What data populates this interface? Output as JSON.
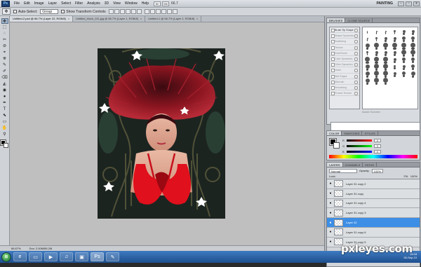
{
  "app": {
    "logo_text": "Ps",
    "menu": [
      "File",
      "Edit",
      "Image",
      "Layer",
      "Select",
      "Filter",
      "Analysis",
      "3D",
      "View",
      "Window",
      "Help"
    ],
    "zoom": "66.7",
    "workspace": "PAINTING",
    "mode_buttons": [
      "Br",
      "Mb"
    ],
    "win_controls": [
      "-",
      "▫",
      "x"
    ]
  },
  "options": {
    "tool_glyph": "✥",
    "auto_select_label": "Auto-Select:",
    "auto_select_value": "Group",
    "show_transform_label": "Show Transform Controls"
  },
  "tabs": [
    {
      "label": "Untitled-2.psd @ 66.7% (Layer 22, RGB/8)",
      "close": "x",
      "active": true
    },
    {
      "label": "Untitled_block_011.jpg @ 66.7% (Layer 1, RGB/8)",
      "close": "x",
      "active": false
    },
    {
      "label": "Untitled-1 @ 66.7% (Layer 1, RGB/8)",
      "close": "x",
      "active": false
    }
  ],
  "toolbox": {
    "tools": [
      "✥",
      "⬚",
      "◌",
      "✂",
      "⊘",
      "⌖",
      "⛯",
      "✎",
      "✐",
      "⌫",
      "◭",
      "◉",
      "●",
      "✒",
      "T",
      "⬉",
      "▭",
      "✋",
      "⚲"
    ]
  },
  "status": {
    "zoom": "66.67%",
    "doc": "Doc: 2.00M/85.2M"
  },
  "brushes": {
    "tabs": [
      "BRUSHES",
      "CLONE SOURCE"
    ],
    "presets": [
      "Brush Tip Shape",
      "Shape Dynamics",
      "Scattering",
      "Texture",
      "Dual Brush",
      "Color Dynamics",
      "Other Dynamics",
      "Noise",
      "Wet Edges",
      "Airbrush",
      "Smoothing",
      "Protect Texture"
    ],
    "master_diameter_label": "Master Diameter",
    "tips": [
      1,
      3,
      5,
      9,
      13,
      19,
      5,
      9,
      13,
      17,
      21,
      27,
      35,
      45,
      65,
      100,
      200,
      300,
      9,
      13,
      19,
      17,
      45,
      65,
      100,
      200,
      300,
      14,
      24,
      27,
      39,
      46,
      59,
      11,
      17,
      23,
      36,
      44,
      60,
      14,
      26,
      33,
      42,
      55,
      70
    ]
  },
  "color": {
    "tabs": [
      "COLOR",
      "SWATCHES",
      "STYLES"
    ],
    "channels": [
      {
        "label": "R",
        "value": "0"
      },
      {
        "label": "G",
        "value": "0"
      },
      {
        "label": "B",
        "value": "0"
      }
    ]
  },
  "layers": {
    "tabs": [
      "LAYERS",
      "CHANNELS",
      "PATHS"
    ],
    "blend_mode": "Normal",
    "opacity_label": "Opacity:",
    "opacity": "100%",
    "lock_label": "Lock:",
    "fill_label": "Fill:",
    "fill": "100%",
    "rows": [
      {
        "name": "Layer 31 copy 2",
        "selected": false
      },
      {
        "name": "Layer 31 copy",
        "selected": false
      },
      {
        "name": "Layer 31 copy 4",
        "selected": false
      },
      {
        "name": "Layer 31 copy 3",
        "selected": false
      },
      {
        "name": "Layer 32",
        "selected": true
      },
      {
        "name": "Layer 31 copy 6",
        "selected": false
      },
      {
        "name": "Layer 31 copy 5",
        "selected": false
      }
    ]
  },
  "taskbar": {
    "start_glyph": "⊞",
    "apps": [
      "e",
      "▭",
      "▶",
      "♫",
      "▣",
      "Ps",
      "✎"
    ],
    "active_index": 5,
    "time": "15:18",
    "date": "26-Sep-10"
  },
  "watermark": "pxleyes.com",
  "colors": {
    "selection": "#3d8ee5",
    "canvas_bg": "#bfbfbf",
    "hair": "#8a1520",
    "gloves": "#e0101c"
  }
}
